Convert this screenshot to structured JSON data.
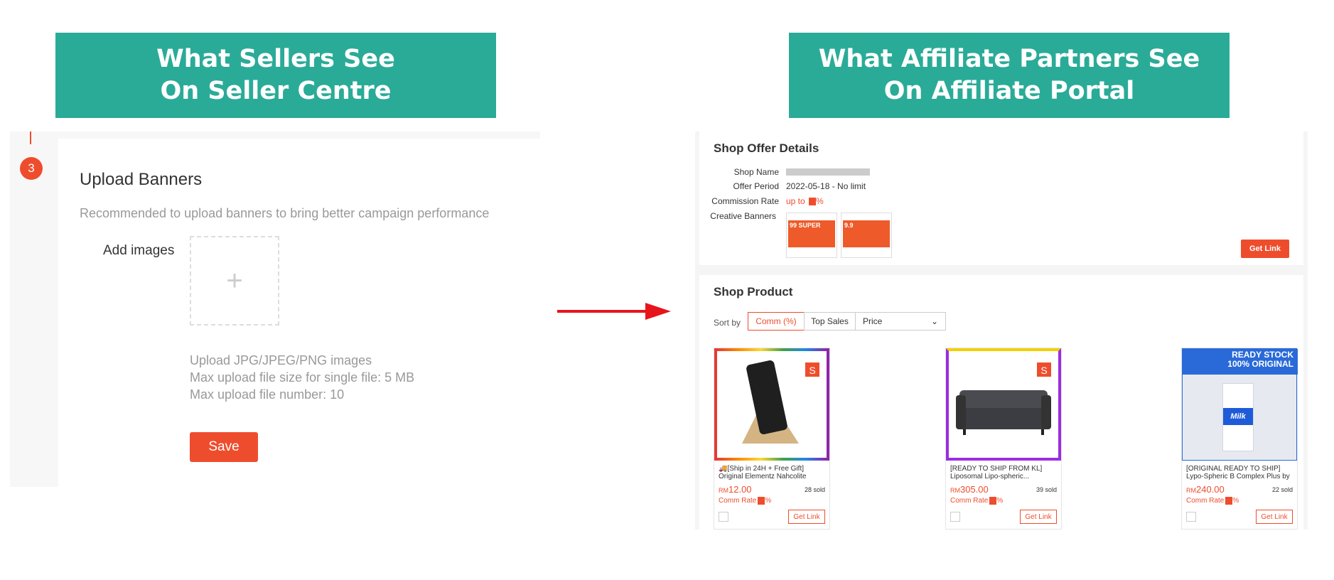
{
  "headers": {
    "left": {
      "line1": "What Sellers See",
      "line2": "On Seller Centre"
    },
    "right": {
      "line1": "What Affiliate Partners See",
      "line2": "On Affiliate Portal"
    }
  },
  "seller_centre": {
    "step_number": "3",
    "title": "Upload Banners",
    "description": "Recommended to upload banners to bring better campaign performance",
    "add_images_label": "Add images",
    "upload_plus": "+",
    "hints": [
      "Upload JPG/JPEG/PNG images",
      "Max upload file size for single file: 5 MB",
      "Max upload file number: 10"
    ],
    "save_label": "Save"
  },
  "affiliate_portal": {
    "offer": {
      "title": "Shop Offer Details",
      "shop_name_label": "Shop Name",
      "offer_period_label": "Offer Period",
      "offer_period_value": "2022-05-18 - No limit",
      "commission_label": "Commission Rate",
      "commission_value": "up to",
      "commission_suffix": "%",
      "banners_label": "Creative Banners",
      "banner1_text": "99 SUPER",
      "banner2_text": "9.9",
      "get_link_label": "Get Link"
    },
    "products": {
      "title": "Shop Product",
      "sort_by_label": "Sort by",
      "sort_options": [
        "Comm (%)",
        "Top Sales"
      ],
      "price_select": "Price",
      "items": [
        {
          "name": "🚚[Ship in 24H + Free Gift] Original Elementz Nahcolite (SODIUM...",
          "currency": "RM",
          "price": "12.00",
          "sold": "28 sold",
          "comm_label": "Comm Rate",
          "comm_suffix": "%",
          "get_link": "Get Link",
          "shop_badge": "Shopee"
        },
        {
          "name": "[READY TO SHIP FROM KL] Liposomal Lipo-spheric...",
          "currency": "RM",
          "price": "305.00",
          "sold": "39 sold",
          "comm_label": "Comm Rate",
          "comm_suffix": "%",
          "get_link": "Get Link"
        },
        {
          "name": "[ORIGINAL READY TO SHIP] Lypo-Spheric B Complex Plus by Livon...",
          "currency": "RM",
          "price": "240.00",
          "sold": "22 sold",
          "comm_label": "Comm Rate",
          "comm_suffix": "%",
          "get_link": "Get Link",
          "banner_line1": "READY STOCK",
          "banner_line2": "100% ORIGINAL",
          "carton_text": "Milk"
        }
      ]
    }
  },
  "colors": {
    "header_bg": "#2aab98",
    "accent": "#ee4d2d",
    "arrow": "#e8141b"
  }
}
